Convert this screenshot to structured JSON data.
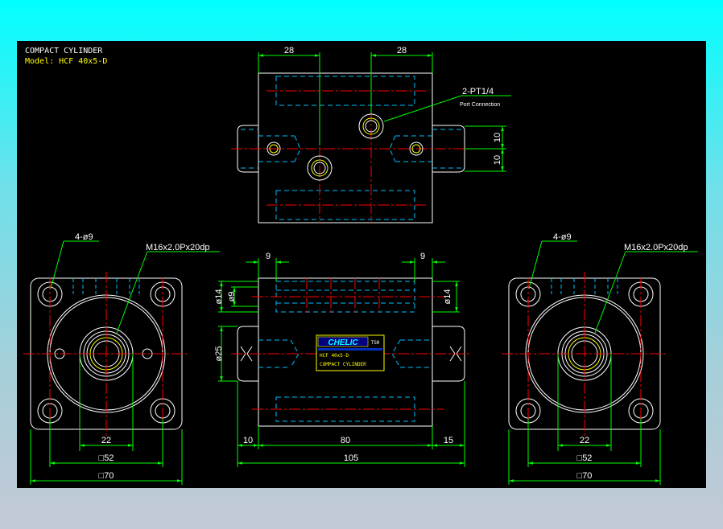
{
  "title": {
    "line1": "COMPACT CYLINDER",
    "line2": "Model:  HCF  40x5-D"
  },
  "top_view": {
    "dim_left": "28",
    "dim_right": "28",
    "port_label": "2-PT1/4",
    "port_sub": "Port Connection",
    "dim_v1": "10",
    "dim_v2": "10"
  },
  "left_view": {
    "holes_label": "4-ø9",
    "thread_label": "M16x2.0Px20dp",
    "dim_22": "22",
    "dim_52": "□52",
    "dim_70": "□70"
  },
  "right_view": {
    "holes_label": "4-ø9",
    "thread_label": "M16x2.0Px20dp",
    "dim_22": "22",
    "dim_52": "□52",
    "dim_70": "□70"
  },
  "front_view": {
    "dim_9_left": "9",
    "dim_9_right": "9",
    "dim_d14_left": "ø14",
    "dim_d9": "ø9",
    "dim_d14_right": "ø14",
    "dim_d25": "ø25",
    "dim_10": "10",
    "dim_80": "80",
    "dim_15": "15",
    "dim_105": "105"
  },
  "nameplate": {
    "brand": "CHELIC",
    "tag": "TSH",
    "model": "HCF 40x5-D",
    "desc": "COMPACT CYLINDER"
  },
  "colors": {
    "background": "#000000",
    "outline": "#ffffff",
    "hidden": "#00bfff",
    "center": "#ff0000",
    "dimension": "#00ff00",
    "title_model": "#ffff00",
    "hatch": "#ffff00",
    "nameplate_bg": "#000080"
  }
}
